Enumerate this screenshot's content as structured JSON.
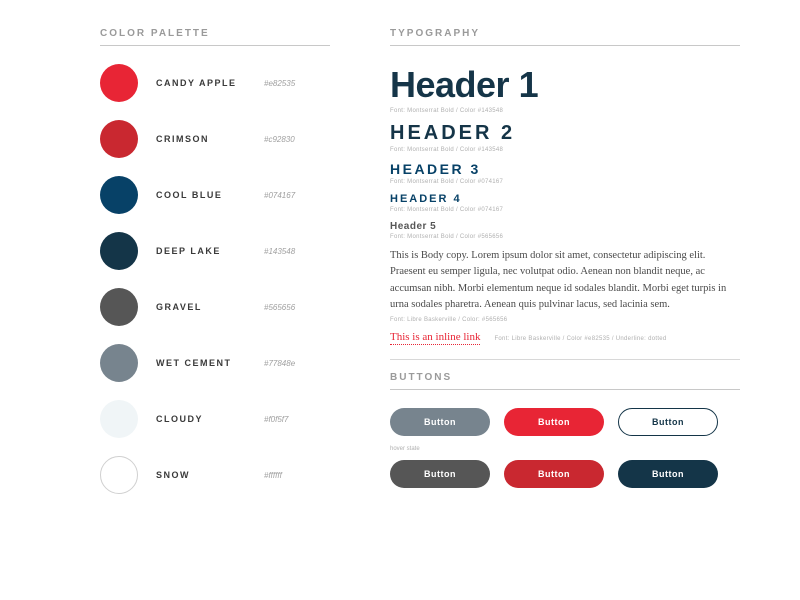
{
  "palette": {
    "title": "COLOR PALETTE",
    "items": [
      {
        "name": "CANDY APPLE",
        "hex": "#e82535"
      },
      {
        "name": "CRIMSON",
        "hex": "#c92830"
      },
      {
        "name": "COOL BLUE",
        "hex": "#074167"
      },
      {
        "name": "DEEP LAKE",
        "hex": "#143548"
      },
      {
        "name": "GRAVEL",
        "hex": "#565656"
      },
      {
        "name": "WET CEMENT",
        "hex": "#77848e"
      },
      {
        "name": "CLOUDY",
        "hex": "#f0f5f7"
      },
      {
        "name": "SNOW",
        "hex": "#ffffff"
      }
    ]
  },
  "typography": {
    "title": "TYPOGRAPHY",
    "h1": {
      "text": "Header 1",
      "spec": "Font: Montserrat Bold / Color #143548"
    },
    "h2": {
      "text": "HEADER 2",
      "spec": "Font: Montserrat Bold / Color #143548"
    },
    "h3": {
      "text": "HEADER 3",
      "spec": "Font: Montserrat Bold / Color #074167"
    },
    "h4": {
      "text": "HEADER 4",
      "spec": "Font: Montserrat Bold / Color #074167"
    },
    "h5": {
      "text": "Header 5",
      "spec": "Font: Montserrat Bold / Color #565656"
    },
    "body": {
      "text": "This is Body copy. Lorem ipsum dolor sit amet, consectetur adipiscing elit. Praesent eu semper ligula, nec volutpat odio. Aenean non blandit neque, ac accumsan nibh. Morbi elementum neque id sodales blandit. Morbi eget turpis in urna sodales pharetra. Aenean quis pulvinar lacus, sed lacinia sem.",
      "spec": "Font: Libre Baskerville / Color: #565656"
    },
    "link": {
      "text": "This is an inline link",
      "spec": "Font: Libre Baskerville / Color #e82535 / Underline: dotted"
    }
  },
  "buttons": {
    "title": "BUTTONS",
    "label": "Button",
    "hover_label": "hover state"
  }
}
